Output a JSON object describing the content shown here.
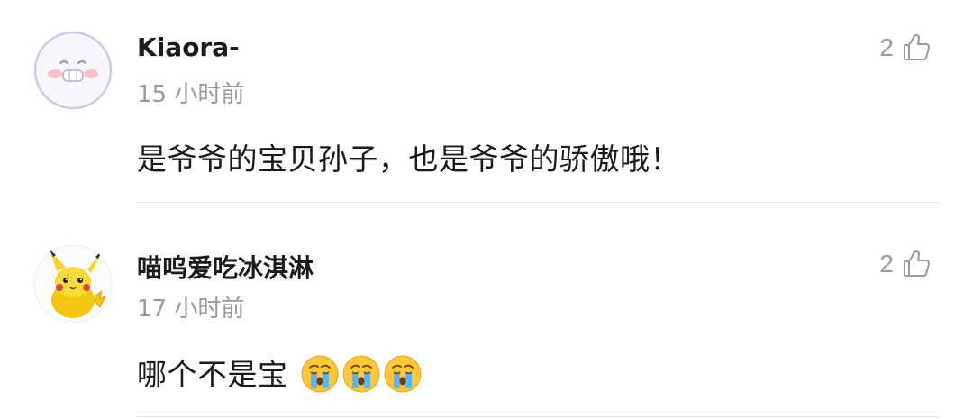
{
  "comments": [
    {
      "username": "Kiaora-",
      "timestamp": "15 小时前",
      "text": "是爷爷的宝贝孙子，也是爷爷的骄傲哦！",
      "likes": "2",
      "avatar": "smiling-face-avatar"
    },
    {
      "username": "喵呜爱吃冰淇淋",
      "timestamp": "17 小时前",
      "text": "哪个不是宝",
      "emojis": [
        "crying-face-emoji",
        "crying-face-emoji",
        "crying-face-emoji"
      ],
      "likes": "2",
      "avatar": "pikachu-avatar"
    }
  ],
  "colors": {
    "text_primary": "#1a1a1a",
    "text_secondary": "#9a9a9a",
    "divider": "#e8e8e8"
  }
}
